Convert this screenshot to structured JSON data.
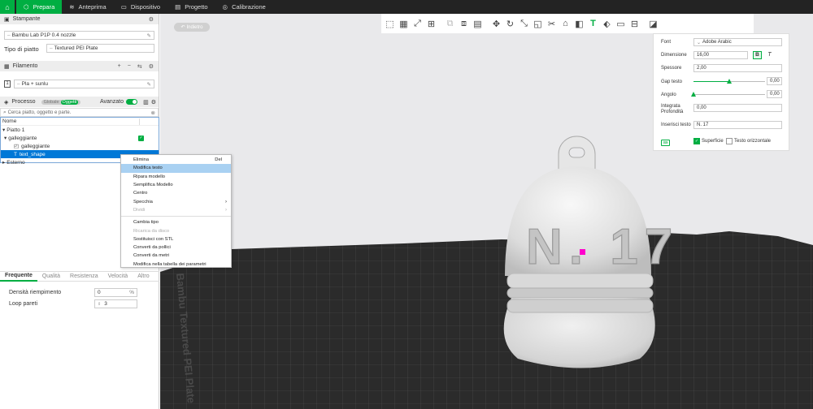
{
  "topbar": {
    "tabs": [
      {
        "label": "Prepara",
        "icon": "cube-icon"
      },
      {
        "label": "Anteprima",
        "icon": "layers-icon"
      },
      {
        "label": "Dispositivo",
        "icon": "monitor-icon"
      },
      {
        "label": "Progetto",
        "icon": "folder-icon"
      },
      {
        "label": "Calibrazione",
        "icon": "target-icon"
      }
    ]
  },
  "printer": {
    "section_title": "Stampante",
    "printer_name": "Bambu Lab P1P 0.4 nozzle",
    "plate_label": "Tipo di piatto",
    "plate_value": "Textured PEI Plate"
  },
  "filament": {
    "section_title": "Filamento",
    "index": "1",
    "value": "Pla + sunlu"
  },
  "process": {
    "section_title": "Processo",
    "mode_global": "Globale",
    "mode_objects": "Oggetti",
    "advanced_label": "Avanzato",
    "search_placeholder": "Cerca piatto, oggetto e parte."
  },
  "object_tree": {
    "header": "Nome",
    "rows": [
      {
        "label": "Piatto 1"
      },
      {
        "label": "galleggiante"
      },
      {
        "label": "galleggiante"
      },
      {
        "label": "text_shape"
      },
      {
        "label": "Esterno"
      }
    ]
  },
  "context_menu": {
    "items": [
      {
        "label": "Elimina",
        "shortcut": "Del"
      },
      {
        "label": "Modifica testo"
      },
      {
        "label": "Ripara modello"
      },
      {
        "label": "Semplifica Modello"
      },
      {
        "label": "Centro"
      },
      {
        "label": "Specchia"
      },
      {
        "label": "Dividi"
      },
      {
        "label": "Cambia tipo"
      },
      {
        "label": "Ricarica da disco"
      },
      {
        "label": "Sostituisci con STL"
      },
      {
        "label": "Converti da pollici"
      },
      {
        "label": "Converti da metri"
      },
      {
        "label": "Modifica nella tabella dei parametri"
      }
    ]
  },
  "param_tabs": [
    "Frequente",
    "Qualità",
    "Resistenza",
    "Velocità",
    "Altro"
  ],
  "params": [
    {
      "label": "Densità riempimento",
      "value": "0",
      "unit": "%"
    },
    {
      "label": "Loop pareti",
      "value": "3"
    }
  ],
  "viewport": {
    "back_button": "Indietro",
    "plate_text": "Bambu Textured PEI Plate",
    "model_text": "N. 17"
  },
  "text_panel": {
    "font_label": "Font",
    "font_value": "Adobe Arabic",
    "size_label": "Dimensione",
    "size_value": "16,00",
    "bold_label": "B",
    "italic_label": "T",
    "thickness_label": "Spessore",
    "thickness_value": "2,00",
    "gap_label": "Gap testo",
    "gap_value": "0,00",
    "gap_fraction": 0.5,
    "angle_label": "Angolo",
    "angle_value": "0,00",
    "angle_fraction": 0.0,
    "depth_label": "Integrata Profondità",
    "depth_value": "0,00",
    "input_label": "Inserisci testo",
    "input_value": "N. 17",
    "surface_label": "Superficie",
    "horizontal_label": "Testo orizzontale"
  },
  "colors": {
    "accent": "#00ae42",
    "topbar": "#232323",
    "selection": "#0078d7",
    "menu_highlight": "#a9d1f2"
  }
}
